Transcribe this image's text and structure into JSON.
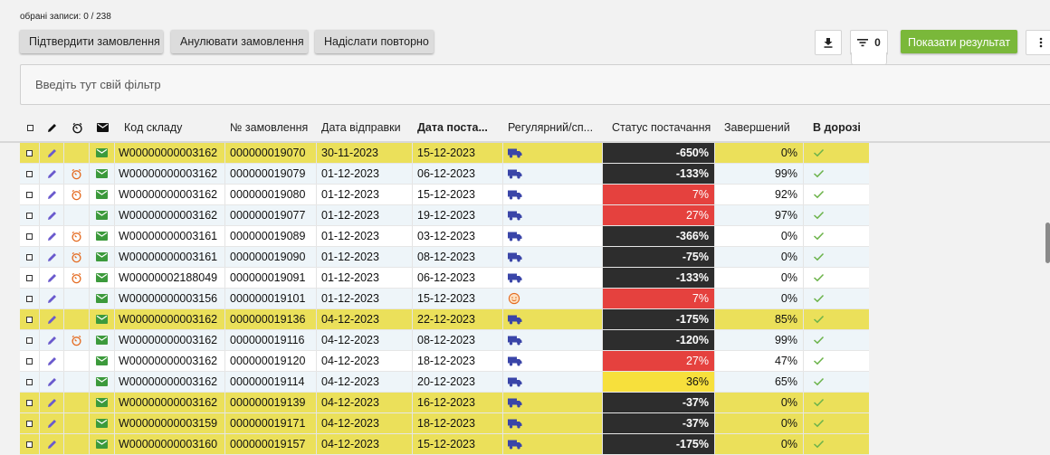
{
  "selection_info": "обрані записи: 0 / 238",
  "actions": {
    "confirm": "Підтвердити замовлення",
    "cancel": "Анулювати замовлення",
    "resend": "Надіслати повторно",
    "filter_count": "0",
    "show_results": "Показати результат"
  },
  "filter": {
    "placeholder": "Введіть тут свій фільтр"
  },
  "columns": {
    "warehouse_code": "Код складу",
    "order_number": "№ замовлення",
    "ship_date": "Дата відправки",
    "delivery_date": "Дата поста...",
    "regular": "Регулярний/сп...",
    "delivery_status": "Статус постачання",
    "completed": "Завершений",
    "in_transit": "В дорозі"
  },
  "colors": {
    "row_yellow": "#ebe05a",
    "row_blue": "#eef5f9",
    "status_black": "#2d2d2d",
    "status_red": "#e5413e",
    "status_gold": "#f7e03c",
    "edit_icon": "#6a5acd",
    "timer_icon": "#e46a1f",
    "mail_icon": "#3c9a3c",
    "truck_icon": "#3a45a8",
    "check_icon": "#6bb34a",
    "show_button": "#7ab83a"
  },
  "rows": [
    {
      "bg": "yellow",
      "timer": false,
      "warehouse": "W00000000003162",
      "order": "000000019070",
      "ship": "30-11-2023",
      "delivery": "15-12-2023",
      "regular_icon": "truck-icon",
      "status": "-650%",
      "status_color": "black",
      "completed": "0%",
      "in_transit": "check-icon"
    },
    {
      "bg": "blue",
      "timer": true,
      "warehouse": "W00000000003162",
      "order": "000000019079",
      "ship": "01-12-2023",
      "delivery": "06-12-2023",
      "regular_icon": "truck-icon",
      "status": "-133%",
      "status_color": "black",
      "completed": "99%",
      "in_transit": "check-icon"
    },
    {
      "bg": "white",
      "timer": true,
      "warehouse": "W00000000003162",
      "order": "000000019080",
      "ship": "01-12-2023",
      "delivery": "15-12-2023",
      "regular_icon": "truck-icon",
      "status": "7%",
      "status_color": "red",
      "completed": "92%",
      "in_transit": "check-icon"
    },
    {
      "bg": "blue",
      "timer": false,
      "warehouse": "W00000000003162",
      "order": "000000019077",
      "ship": "01-12-2023",
      "delivery": "19-12-2023",
      "regular_icon": "truck-icon",
      "status": "27%",
      "status_color": "red",
      "completed": "97%",
      "in_transit": "check-icon"
    },
    {
      "bg": "white",
      "timer": true,
      "warehouse": "W00000000003161",
      "order": "000000019089",
      "ship": "01-12-2023",
      "delivery": "03-12-2023",
      "regular_icon": "truck-icon",
      "status": "-366%",
      "status_color": "black",
      "completed": "0%",
      "in_transit": "check-icon"
    },
    {
      "bg": "blue",
      "timer": true,
      "warehouse": "W00000000003161",
      "order": "000000019090",
      "ship": "01-12-2023",
      "delivery": "08-12-2023",
      "regular_icon": "truck-icon",
      "status": "-75%",
      "status_color": "black",
      "completed": "0%",
      "in_transit": "check-icon"
    },
    {
      "bg": "white",
      "timer": true,
      "warehouse": "W00000002188049",
      "order": "000000019091",
      "ship": "01-12-2023",
      "delivery": "06-12-2023",
      "regular_icon": "truck-icon",
      "status": "-133%",
      "status_color": "black",
      "completed": "0%",
      "in_transit": "check-icon"
    },
    {
      "bg": "blue",
      "timer": false,
      "warehouse": "W00000000003156",
      "order": "000000019101",
      "ship": "01-12-2023",
      "delivery": "15-12-2023",
      "regular_icon": "smiley-icon",
      "status": "7%",
      "status_color": "red",
      "completed": "0%",
      "in_transit": "check-icon"
    },
    {
      "bg": "yellow",
      "timer": false,
      "warehouse": "W00000000003162",
      "order": "000000019136",
      "ship": "04-12-2023",
      "delivery": "22-12-2023",
      "regular_icon": "truck-icon",
      "status": "-175%",
      "status_color": "black",
      "completed": "85%",
      "in_transit": "check-icon"
    },
    {
      "bg": "blue",
      "timer": true,
      "warehouse": "W00000000003162",
      "order": "000000019116",
      "ship": "04-12-2023",
      "delivery": "08-12-2023",
      "regular_icon": "truck-icon",
      "status": "-120%",
      "status_color": "black",
      "completed": "99%",
      "in_transit": "check-icon"
    },
    {
      "bg": "white",
      "timer": false,
      "warehouse": "W00000000003162",
      "order": "000000019120",
      "ship": "04-12-2023",
      "delivery": "18-12-2023",
      "regular_icon": "truck-icon",
      "status": "27%",
      "status_color": "red",
      "completed": "47%",
      "in_transit": "check-icon"
    },
    {
      "bg": "blue",
      "timer": false,
      "warehouse": "W00000000003162",
      "order": "000000019114",
      "ship": "04-12-2023",
      "delivery": "20-12-2023",
      "regular_icon": "truck-icon",
      "status": "36%",
      "status_color": "gold",
      "completed": "65%",
      "in_transit": "check-icon"
    },
    {
      "bg": "yellow",
      "timer": false,
      "warehouse": "W00000000003162",
      "order": "000000019139",
      "ship": "04-12-2023",
      "delivery": "16-12-2023",
      "regular_icon": "truck-icon",
      "status": "-37%",
      "status_color": "black",
      "completed": "0%",
      "in_transit": "check-icon"
    },
    {
      "bg": "yellow",
      "timer": false,
      "warehouse": "W00000000003159",
      "order": "000000019171",
      "ship": "04-12-2023",
      "delivery": "18-12-2023",
      "regular_icon": "truck-icon",
      "status": "-37%",
      "status_color": "black",
      "completed": "0%",
      "in_transit": "check-icon"
    },
    {
      "bg": "yellow",
      "timer": false,
      "warehouse": "W00000000003160",
      "order": "000000019157",
      "ship": "04-12-2023",
      "delivery": "15-12-2023",
      "regular_icon": "truck-icon",
      "status": "-175%",
      "status_color": "black",
      "completed": "0%",
      "in_transit": "check-icon"
    }
  ]
}
